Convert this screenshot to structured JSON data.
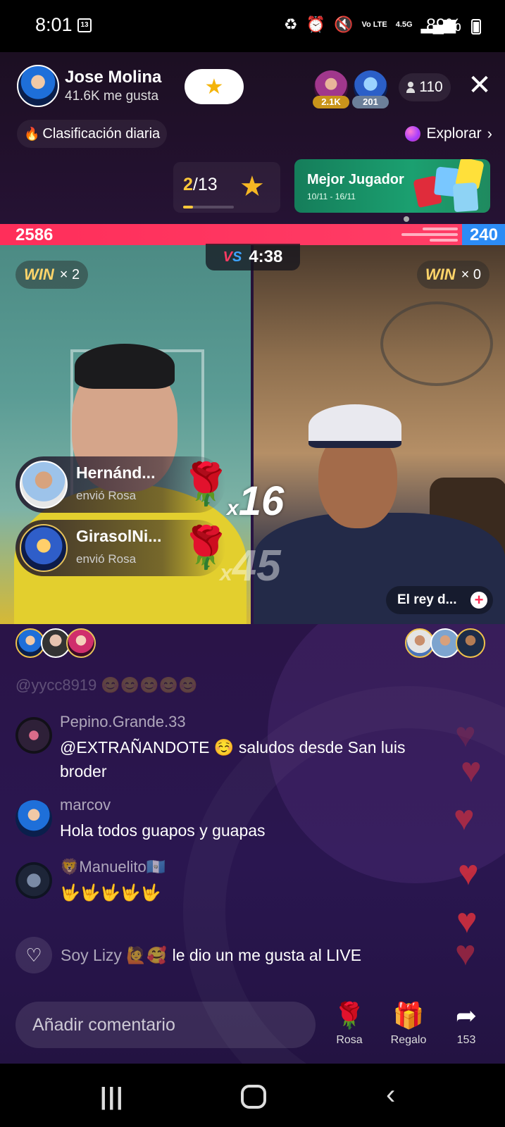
{
  "status_bar": {
    "time": "8:01",
    "calendar_day": "13",
    "network": "4.5G",
    "volte": "Vo LTE",
    "battery": "89%"
  },
  "host": {
    "name": "Jose Molina",
    "likes": "41.6K me gusta"
  },
  "top_viewers": [
    {
      "badge": "2.1K"
    },
    {
      "badge": "201"
    }
  ],
  "viewer_count": "110",
  "ranking": {
    "label": "Clasificación diaria"
  },
  "explore": {
    "label": "Explorar"
  },
  "round": {
    "current": "2",
    "total": "/13"
  },
  "best_player": {
    "title": "Mejor Jugador",
    "dates": "10/11 - 16/11"
  },
  "battle": {
    "left_score": "2586",
    "right_score": "240",
    "left_share": 0.915,
    "timer": "4:38",
    "vs_label": "VS"
  },
  "wins": {
    "label": "WIN",
    "left": "× 2",
    "right": "× 0"
  },
  "opponent": {
    "name": "El rey d..."
  },
  "gifts": [
    {
      "user": "Hernánd...",
      "action": "envió Rosa",
      "combo_x": "x",
      "combo": "16"
    },
    {
      "user": "GirasolNi...",
      "action": "envió Rosa",
      "combo_x": "x",
      "combo": "45"
    }
  ],
  "chat": {
    "faded_line": "@yycc8919 😊😊😊😊😊",
    "messages": [
      {
        "user": "Pepino.Grande.33",
        "text": "@EXTRAÑANDOTE ☺️ saludos desde San luis broder"
      },
      {
        "user": "marcov",
        "text": "Hola todos guapos y guapas"
      },
      {
        "user": "🦁Manuelito🇬🇹",
        "text": "🤟🤟🤟🤟🤟"
      }
    ],
    "like_event": {
      "user": "Soy Lizy 🙋🥰",
      "text": "le dio un me gusta al LIVE"
    }
  },
  "bottom_bar": {
    "comment_placeholder": "Añadir comentario",
    "rose_label": "Rosa",
    "gift_label": "Regalo",
    "share_count": "153"
  },
  "icons": {
    "follow": "star-icon",
    "close": "close-icon",
    "ranking": "flame-icon",
    "explore": "planet-icon",
    "like": "heart-icon",
    "rose": "rose-icon",
    "gift": "gift-icon",
    "share": "share-icon"
  },
  "colors": {
    "battle_red": "#ff2e5a",
    "battle_blue": "#2c8cf5",
    "best_player_green": "#1ba070",
    "heart_red": "#d12f3e"
  }
}
